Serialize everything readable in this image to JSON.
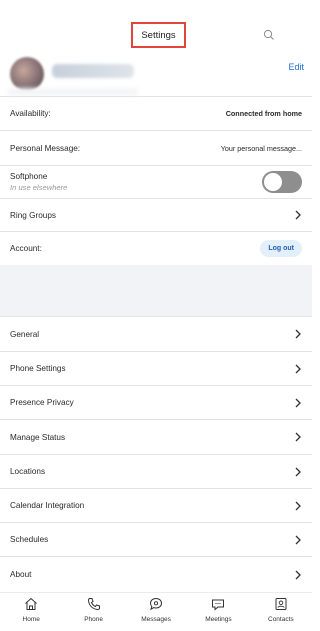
{
  "header": {
    "title": "Settings",
    "search_icon": "search-icon"
  },
  "profile": {
    "edit_label": "Edit"
  },
  "rows": {
    "availability": {
      "label": "Availability:",
      "value": "Connected from home"
    },
    "personal_message": {
      "label": "Personal Message:",
      "value": "Your personal message..."
    },
    "softphone": {
      "label": "Softphone",
      "sublabel": "In use elsewhere",
      "toggle_on": false
    },
    "ring_groups": {
      "label": "Ring Groups"
    },
    "account": {
      "label": "Account:",
      "button": "Log out"
    }
  },
  "menu": [
    {
      "label": "General"
    },
    {
      "label": "Phone Settings"
    },
    {
      "label": "Presence Privacy"
    },
    {
      "label": "Manage Status"
    },
    {
      "label": "Locations"
    },
    {
      "label": "Calendar Integration"
    },
    {
      "label": "Schedules"
    },
    {
      "label": "About"
    }
  ],
  "tabbar": [
    {
      "label": "Home",
      "icon": "home-icon"
    },
    {
      "label": "Phone",
      "icon": "phone-icon"
    },
    {
      "label": "Messages",
      "icon": "messages-icon"
    },
    {
      "label": "Meetings",
      "icon": "meetings-icon"
    },
    {
      "label": "Contacts",
      "icon": "contacts-icon"
    }
  ],
  "colors": {
    "accent": "#1f6fd1",
    "highlight_box": "#e0443a",
    "toggle_off": "#8e8e8e"
  }
}
